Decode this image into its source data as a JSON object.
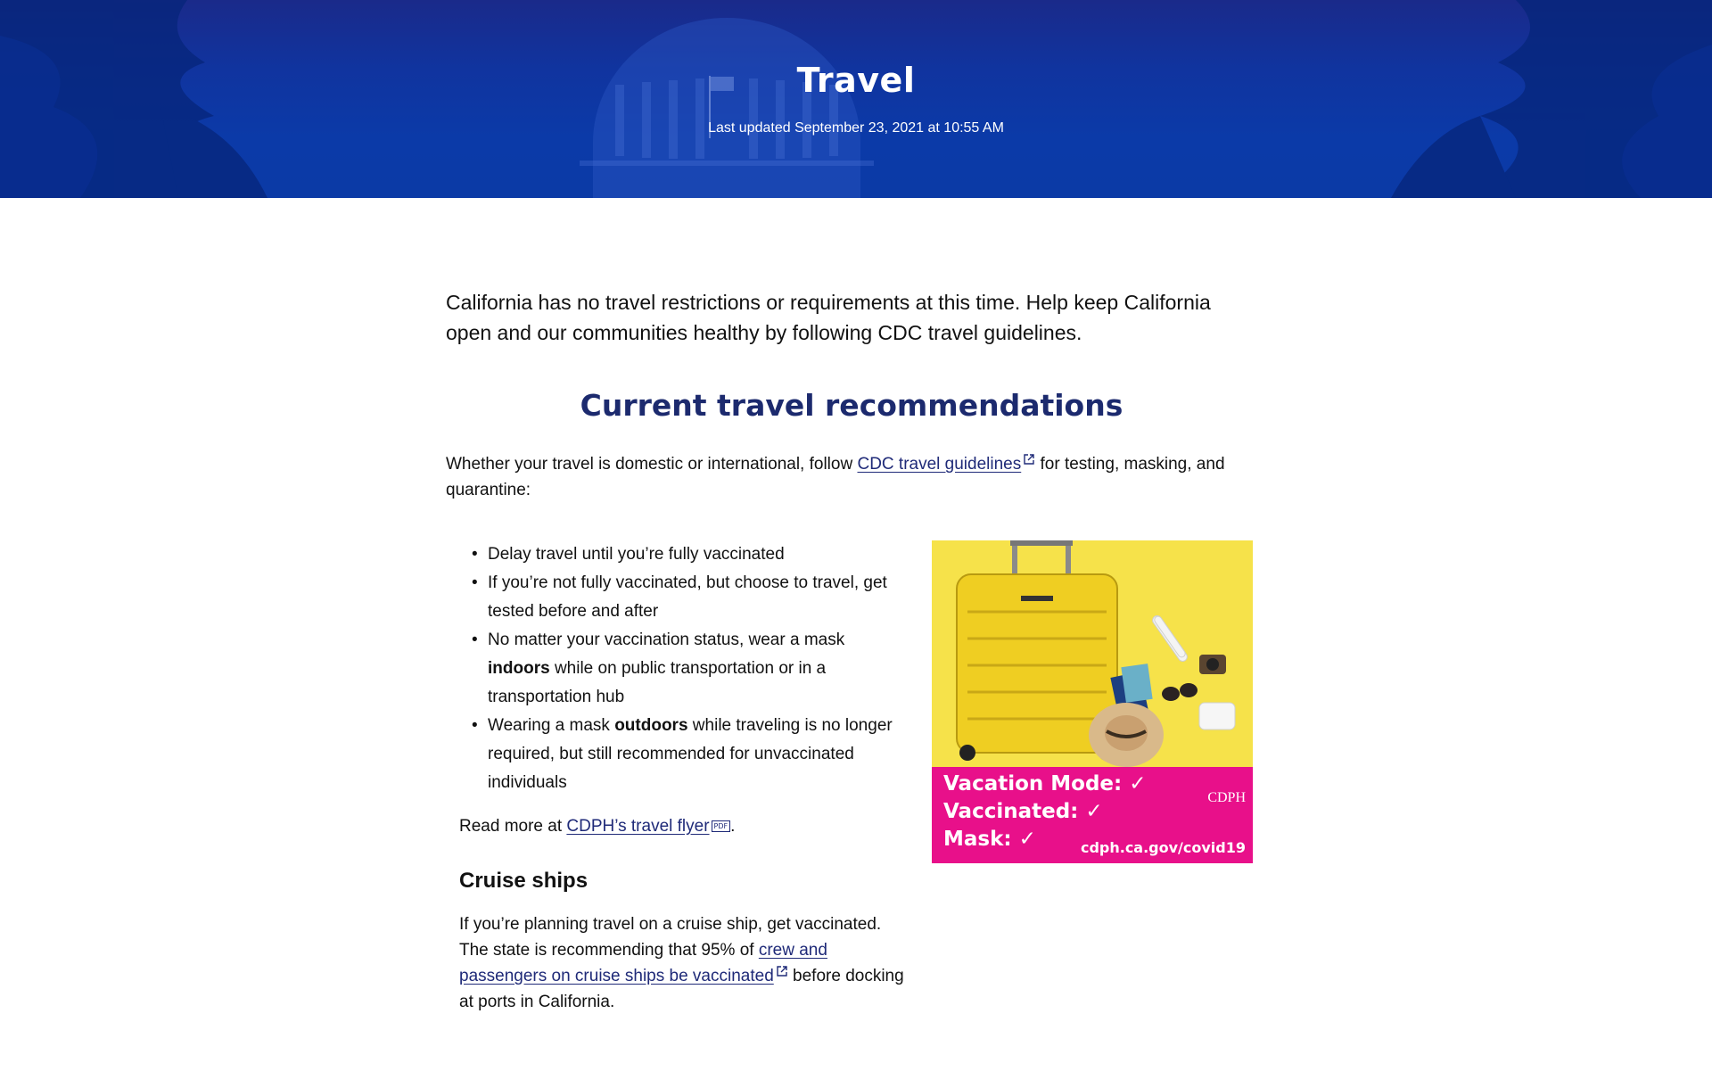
{
  "hero": {
    "title": "Travel",
    "updated": "Last updated September 23, 2021 at 10:55 AM"
  },
  "intro": "California has no travel restrictions or requirements at this time. Help keep California open and our communities healthy by following CDC travel guidelines.",
  "recommendations": {
    "heading": "Current travel recommendations",
    "lead_before": "Whether your travel is domestic or international, follow ",
    "lead_link": "CDC travel guidelines",
    "lead_after": " for testing, masking, and quarantine:",
    "items": [
      {
        "text": "Delay travel until you’re fully vaccinated"
      },
      {
        "text": "If you’re not fully vaccinated, but choose to travel, get tested before and after"
      },
      {
        "before": "No matter your vaccination status, wear a mask ",
        "bold": "indoors",
        "after": " while on public transportation or in a transportation hub"
      },
      {
        "before": "Wearing a mask ",
        "bold": "outdoors",
        "after": " while traveling is no longer required, but still recommended for unvaccinated individuals"
      }
    ],
    "read_more_before": "Read more at ",
    "read_more_link": "CDPH’s travel flyer",
    "pdf_badge": "PDF",
    "read_more_after": "."
  },
  "promo": {
    "line1": "Vacation Mode:",
    "line2": "Vaccinated:",
    "line3": "Mask:",
    "check": "✓",
    "logo": "CDPH",
    "url": "cdph.ca.gov/covid19",
    "colors": {
      "photo_bg": "#f6e24a",
      "band": "#e8108a"
    }
  },
  "cruise": {
    "heading": "Cruise ships",
    "text_before": "If you’re planning travel on a cruise ship, get vaccinated. The state is recommending that 95% of ",
    "link": "crew and passengers on cruise ships be vaccinated",
    "text_after": " before docking at ports in California."
  },
  "colors": {
    "hero": "#0b3aa8",
    "heading": "#1c2a6e",
    "link": "#1f2a78"
  }
}
